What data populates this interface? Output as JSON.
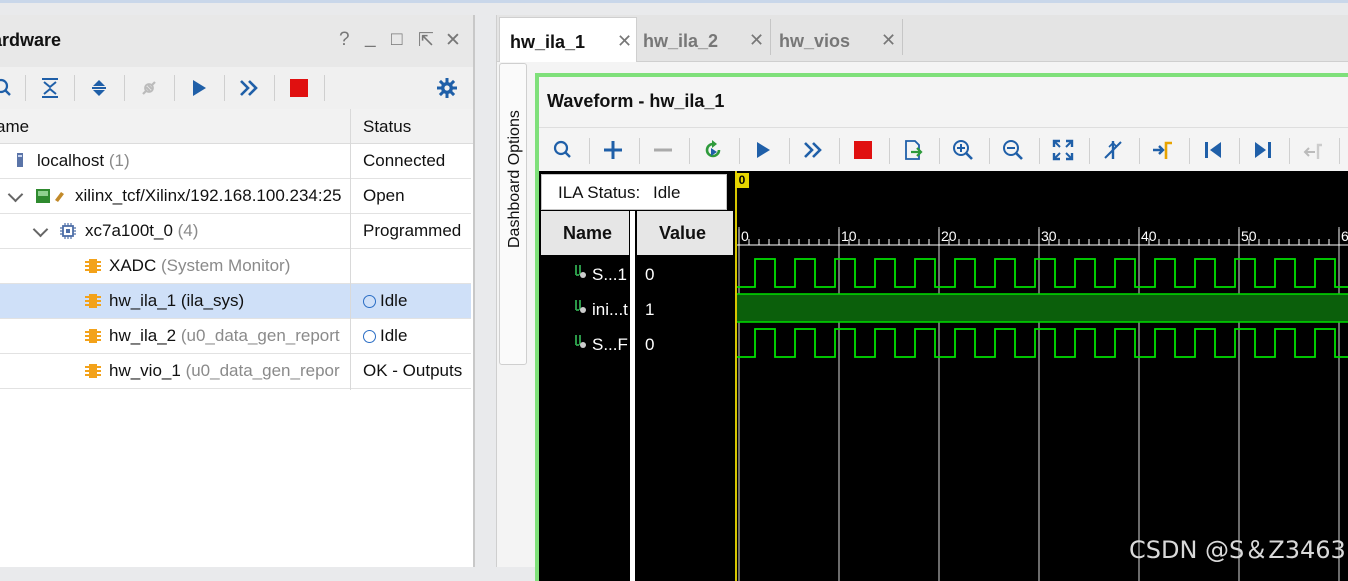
{
  "hardware_panel": {
    "title": "ardware",
    "window_controls": [
      "?",
      "_",
      "□",
      "⇱",
      "✕"
    ],
    "column_name": "ame",
    "column_status": "Status",
    "rows": [
      {
        "name": "localhost",
        "extra": "(1)",
        "status": "Connected"
      },
      {
        "name": "xilinx_tcf/Xilinx/192.168.100.234:25",
        "extra": "",
        "status": "Open"
      },
      {
        "name": "xc7a100t_0",
        "extra": "(4)",
        "status": "Programmed"
      },
      {
        "name": "XADC",
        "extra": "(System Monitor)",
        "status": ""
      },
      {
        "name": "hw_ila_1",
        "extra": "(ila_sys)",
        "status": "Idle"
      },
      {
        "name": "hw_ila_2",
        "extra": "(u0_data_gen_report",
        "status": "Idle"
      },
      {
        "name": "hw_vio_1",
        "extra": "(u0_data_gen_repor",
        "status": "OK - Outputs"
      }
    ]
  },
  "tabs": [
    {
      "label": "hw_ila_1",
      "close": "✕",
      "active": true
    },
    {
      "label": "hw_ila_2",
      "close": "✕",
      "active": false
    },
    {
      "label": "hw_vios",
      "close": "✕",
      "active": false
    }
  ],
  "dashboard_label": "Dashboard Options",
  "waveform": {
    "title": "Waveform - hw_ila_1",
    "ila_status_label": "ILA Status:",
    "ila_status_value": "Idle",
    "col_name": "Name",
    "col_value": "Value",
    "cursor_label": "0",
    "ruler_labels": [
      "0",
      "10",
      "20",
      "30",
      "40",
      "50",
      "6"
    ],
    "signals": [
      {
        "name": "S...1",
        "value": "0",
        "kind": "clock-low-start"
      },
      {
        "name": "ini...t",
        "value": "1",
        "kind": "constant-high"
      },
      {
        "name": "S...F",
        "value": "0",
        "kind": "clock-low-start"
      }
    ]
  },
  "watermark": "CSDN @S＆Z3463",
  "colors": {
    "selection": "#cfe0f8",
    "waveform_green": "#00e000",
    "frame_green": "#7fe07a",
    "stop_red": "#e01010",
    "run_blue": "#1f5fa8"
  }
}
